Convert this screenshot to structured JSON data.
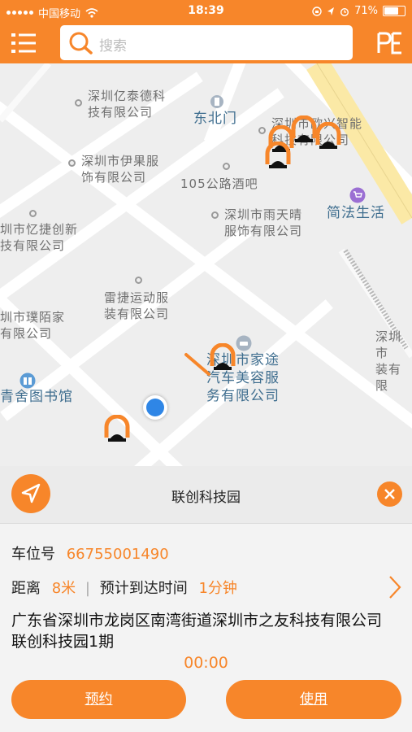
{
  "status_bar": {
    "carrier": "中国移动",
    "time": "18:39",
    "battery": "71%",
    "battery_level": 0.71
  },
  "header": {
    "search_placeholder": "搜索",
    "menu_icon": "list-menu-icon",
    "right_icon": "pe-icon"
  },
  "map": {
    "pois": [
      {
        "text": "深圳亿泰德科\n技有限公司"
      },
      {
        "text": "东北门"
      },
      {
        "text": "深圳市欧兴智能\n科技有限公司"
      },
      {
        "text": "深圳市伊果服\n饰有限公司"
      },
      {
        "text": "105公路酒吧"
      },
      {
        "text": "简法生活"
      },
      {
        "text": "深圳市雨天晴\n服饰有限公司"
      },
      {
        "text": "圳市忆捷创新\n技有限公司"
      },
      {
        "text": "雷捷运动服\n装有限公司"
      },
      {
        "text": "圳市璞陌家\n有限公司"
      },
      {
        "text": "深圳市\n装有限"
      },
      {
        "text": "深圳市家途\n汽车美容服\n务有限公司"
      },
      {
        "text": "青舍图书馆"
      }
    ]
  },
  "panel": {
    "title": "联创科技园",
    "spot_label": "车位号",
    "spot_number": "66755001490",
    "distance_label": "距离",
    "distance_value": "8米",
    "eta_label": "预计到达时间",
    "eta_value": "1分钟",
    "address": "广东省深圳市龙岗区南湾街道深圳市之友科技有限公司联创科技园1期",
    "timer": "00:00",
    "reserve_button": "预约",
    "use_button": "使用"
  },
  "colors": {
    "accent": "#f7862a",
    "location_blue": "#2f86e6",
    "map_bg": "#eeeeee",
    "road_yellow": "#fbe9a6"
  }
}
